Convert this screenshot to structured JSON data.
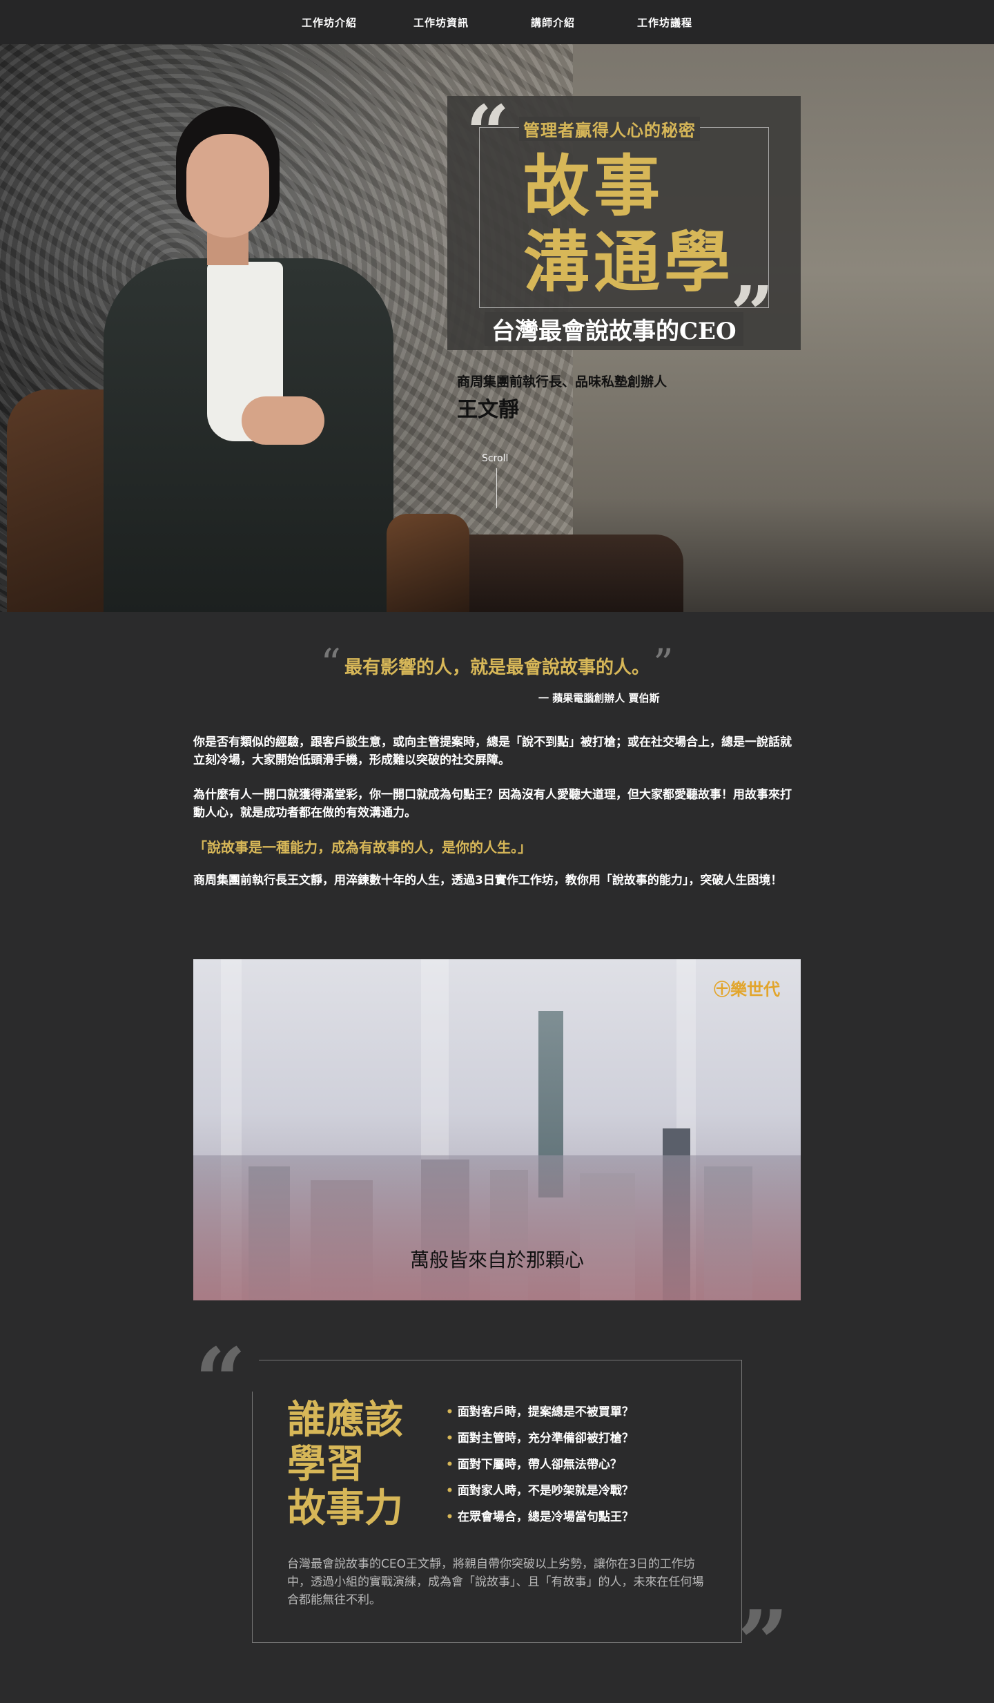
{
  "nav": {
    "items": [
      "工作坊介紹",
      "工作坊資訊",
      "講師介紹",
      "工作坊議程"
    ]
  },
  "hero": {
    "title_sub": "管理者贏得人心的秘密",
    "title_line1": "故事",
    "title_line2": "溝通學",
    "tagline": "台灣最會說故事的CEO",
    "speaker_role": "商周集團前執行長、品味私塾創辦人",
    "speaker_name": "王文靜",
    "scroll_label": "Scroll",
    "quote_open": "“",
    "quote_close": "”"
  },
  "intro": {
    "quote": "最有影響的人，就是最會說故事的人。",
    "quote_open": "“",
    "quote_close": "”",
    "attribution": "一 蘋果電腦創辦人 賈伯斯",
    "paragraphs": [
      "你是否有類似的經驗，跟客戶談生意，或向主管提案時，總是「說不到點」被打槍；或在社交場合上，總是一說話就立刻冷場，大家開始低頭滑手機，形成難以突破的社交屏障。",
      "為什麼有人一開口就獲得滿堂彩，你一開口就成為句點王？因為沒有人愛聽大道理，但大家都愛聽故事！用故事來打動人心，就是成功者都在做的有效溝通力。",
      "「說故事是一種能力，成為有故事的人，是你的人生。」",
      "商周集團前執行長王文靜，用淬鍊數十年的人生，透過3日實作工作坊，教你用「說故事的能力」，突破人生困境！"
    ]
  },
  "video": {
    "logo": "㊉樂世代",
    "subtitle": "萬般皆來自於那顆心"
  },
  "who": {
    "title_line1": "誰應該",
    "title_line2": "學習",
    "title_line3": "故事力",
    "bullet": "•",
    "items": [
      "面對客戶時，提案總是不被買單？",
      "面對主管時，充分準備卻被打槍？",
      "面對下屬時，帶人卻無法帶心？",
      "面對家人時，不是吵架就是冷戰？",
      "在眾會場合，總是冷場當句點王？"
    ],
    "description": "台灣最會說故事的CEO王文靜，將親自帶你突破以上劣勢，讓你在3日的工作坊中，透過小組的實戰演練，成為會「說故事」、且「有故事」的人，未來在任何場合都能無往不利。",
    "quote_open": "“",
    "quote_close": "”"
  },
  "colors": {
    "accent": "#d7b758",
    "background": "#2b2b2c",
    "nav": "#262627"
  }
}
